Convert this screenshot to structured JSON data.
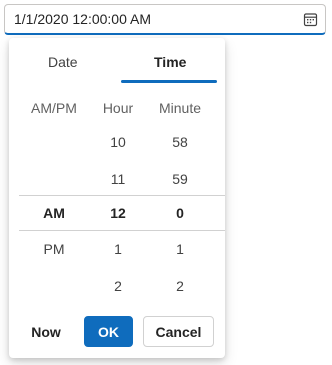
{
  "input": {
    "value": "1/1/2020 12:00:00 AM",
    "icon": "calendar-icon"
  },
  "tabs": {
    "date_label": "Date",
    "time_label": "Time",
    "active": "Time"
  },
  "columns": {
    "ampm_header": "AM/PM",
    "hour_header": "Hour",
    "minute_header": "Minute"
  },
  "picker": {
    "ampm": [
      "",
      "",
      "AM",
      "PM",
      ""
    ],
    "hours": [
      "10",
      "11",
      "12",
      "1",
      "2"
    ],
    "minutes": [
      "58",
      "59",
      "0",
      "1",
      "2"
    ],
    "selected_index": 2
  },
  "footer": {
    "now_label": "Now",
    "ok_label": "OK",
    "cancel_label": "Cancel"
  },
  "colors": {
    "accent": "#0f6cbd"
  }
}
